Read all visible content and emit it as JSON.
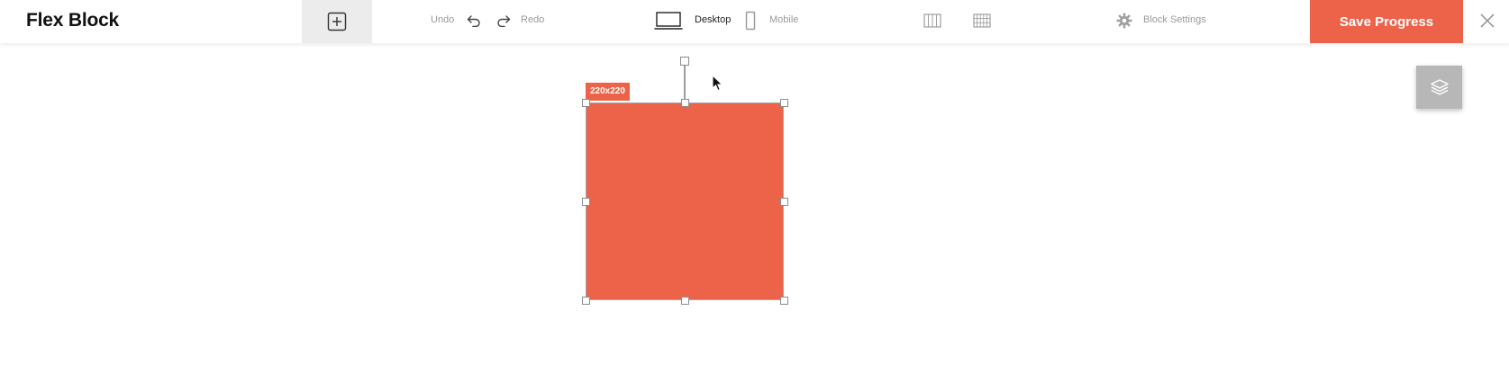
{
  "app": {
    "title": "Flex Block"
  },
  "toolbar": {
    "undo_label": "Undo",
    "redo_label": "Redo",
    "desktop_label": "Desktop",
    "mobile_label": "Mobile",
    "block_settings_label": "Block Settings",
    "save_label": "Save Progress",
    "active_view": "Desktop",
    "icons": {
      "add": "plus-square-icon",
      "undo": "undo-arrow-icon",
      "redo": "redo-arrow-icon",
      "desktop": "laptop-icon",
      "mobile": "phone-icon",
      "columns": "column-grid-icon",
      "grid": "grid-icon",
      "settings": "gear-icon",
      "close": "close-icon",
      "layers": "layers-icon"
    }
  },
  "canvas": {
    "selected_block": {
      "size_label": "220x220",
      "fill_color": "#ec634a"
    }
  },
  "colors": {
    "accent": "#ec634a",
    "muted_text": "#9a9a9a",
    "layers_button": "#b7b7b7"
  }
}
